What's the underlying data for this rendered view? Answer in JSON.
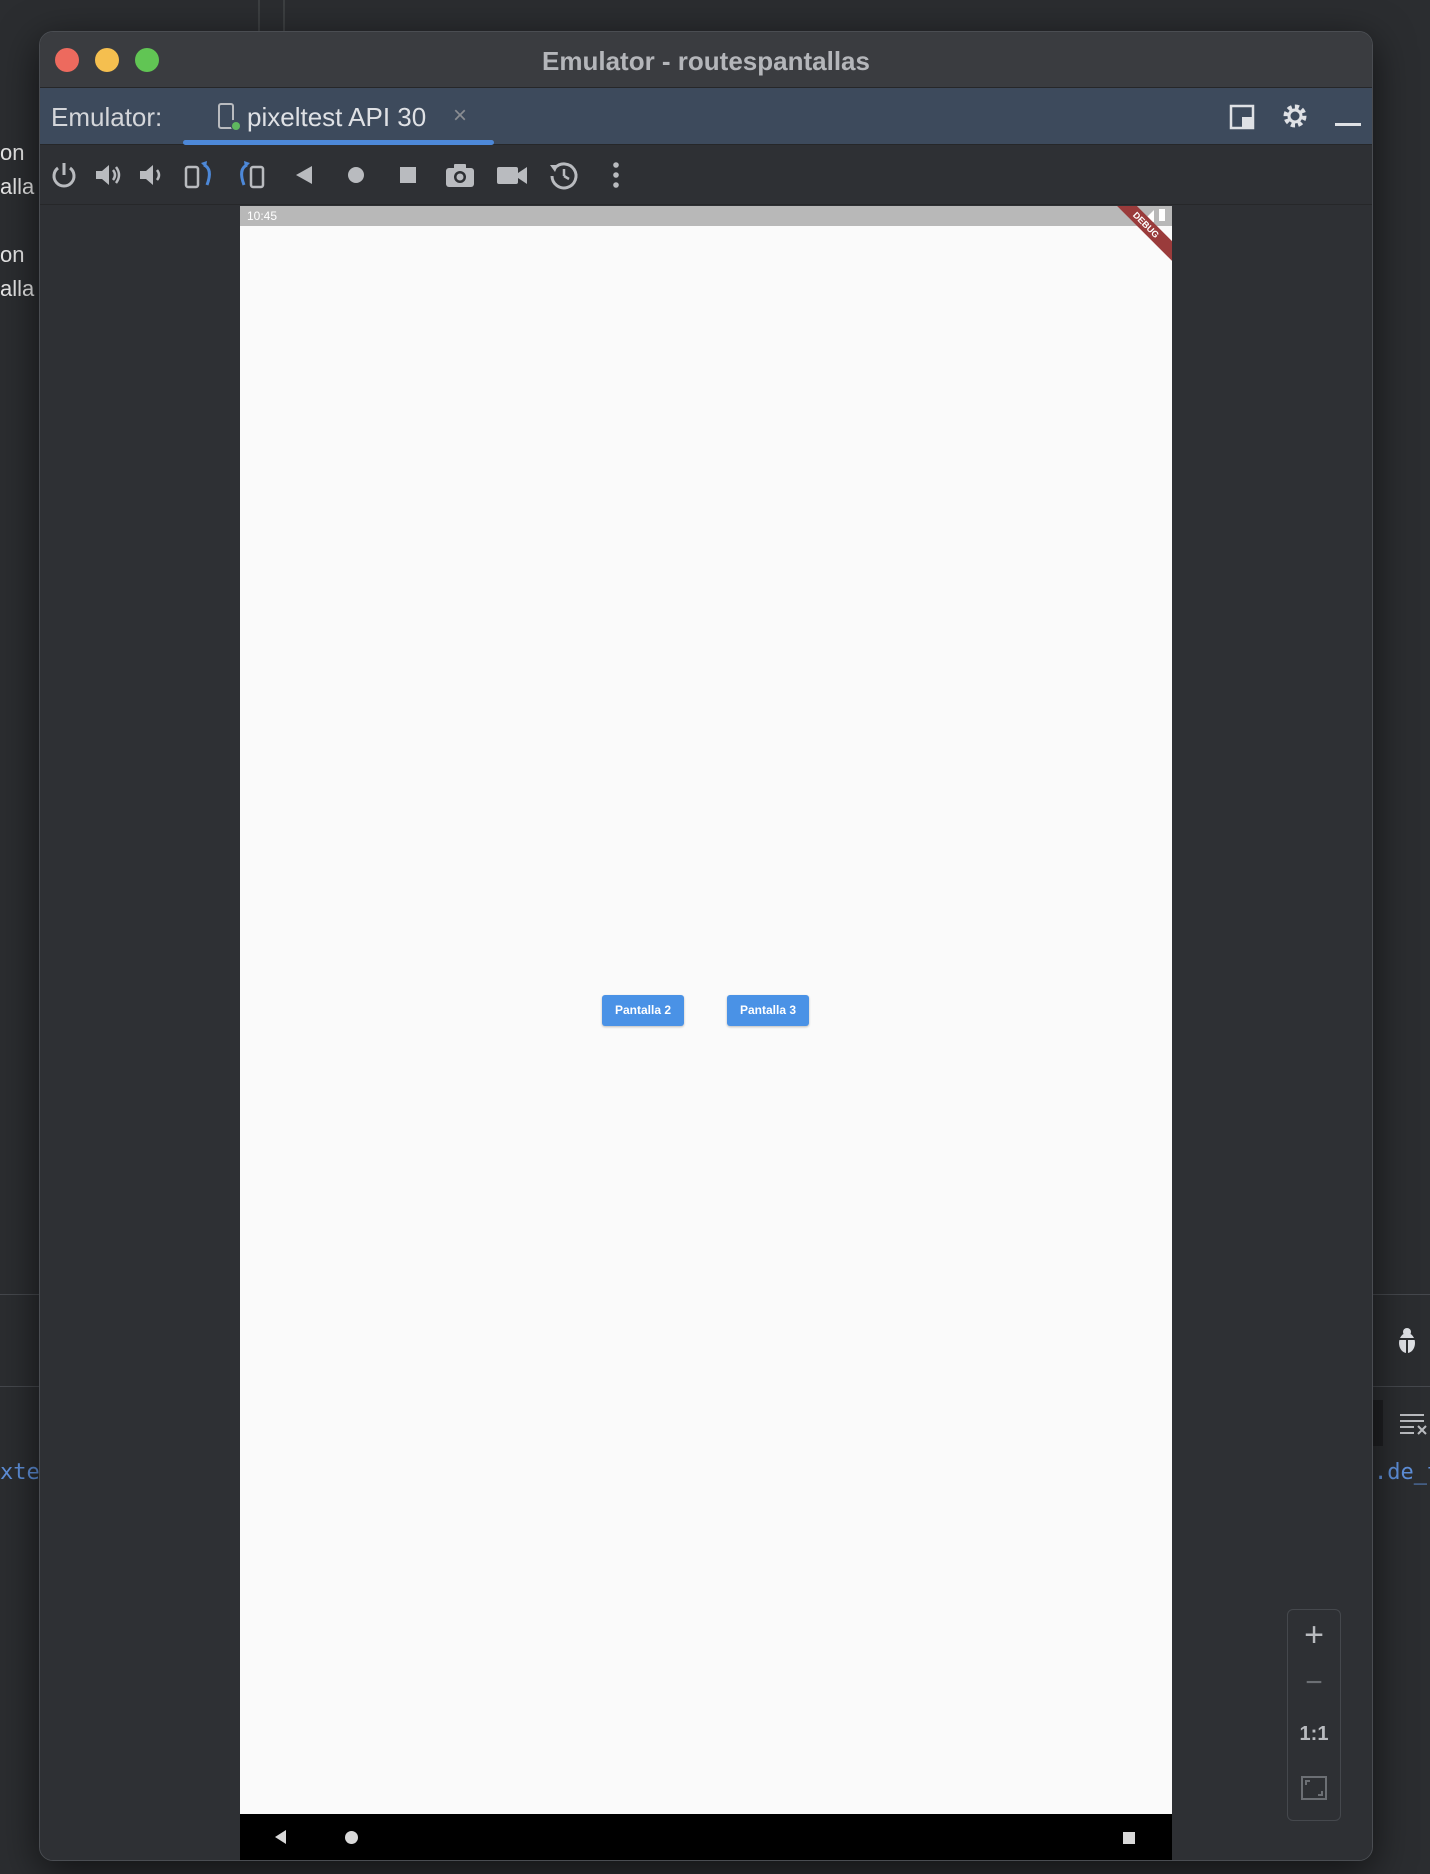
{
  "background": {
    "left_fragments": [
      "on",
      "alla",
      "on",
      "alla"
    ],
    "code_left": "xte",
    "code_right": ".de_t"
  },
  "window": {
    "title": "Emulator - routespantallas",
    "tabbar_label": "Emulator:",
    "tab": {
      "label": "pixeltest API 30",
      "close": "×"
    }
  },
  "toolbar": {
    "icons": [
      "power-icon",
      "volume-up-icon",
      "volume-down-icon",
      "rotate-left-icon",
      "rotate-right-icon",
      "back-icon",
      "home-icon",
      "overview-icon",
      "screenshot-icon",
      "screen-record-icon",
      "snapshot-icon",
      "more-icon"
    ]
  },
  "phone": {
    "time": "10:45",
    "debug_banner": "DEBUG",
    "buttons": [
      {
        "label": "Pantalla 2"
      },
      {
        "label": "Pantalla 3"
      }
    ]
  },
  "zoom": {
    "plus": "+",
    "minus": "−",
    "one_to_one": "1:1"
  },
  "colors": {
    "accent": "#4d88d8",
    "app_button": "#4a92e6",
    "debug_banner": "#9a3b3b"
  }
}
